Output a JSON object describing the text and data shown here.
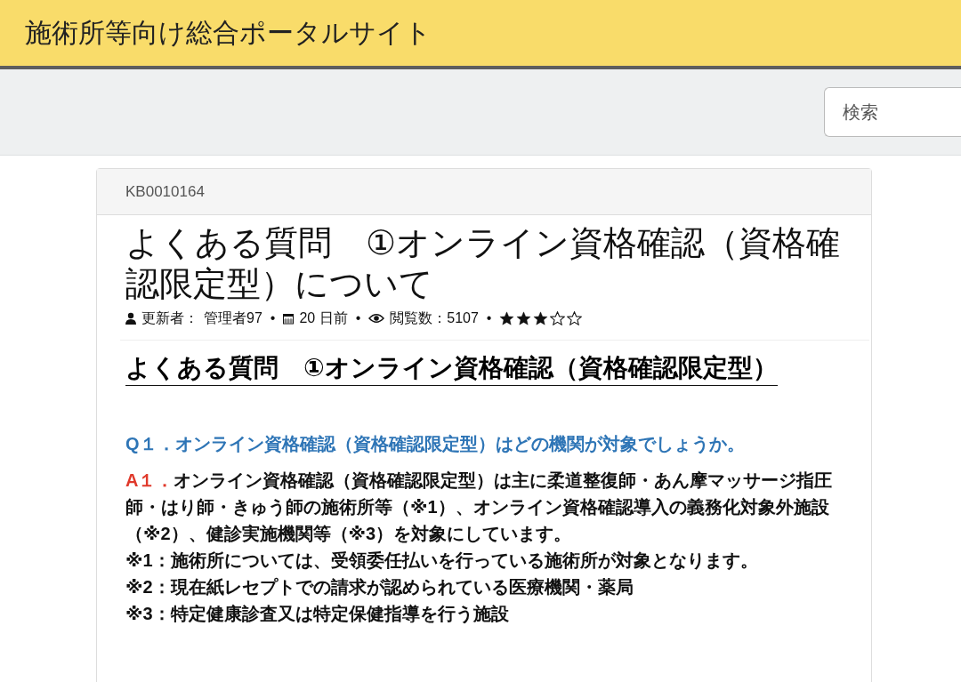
{
  "header": {
    "title": "施術所等向け総合ポータルサイト"
  },
  "search": {
    "placeholder": "検索"
  },
  "article": {
    "number": "KB0010164",
    "title": "よくある質問　①オンライン資格確認（資格確認限定型）について",
    "meta": {
      "updated_by_label": "更新者：",
      "updated_by": "管理者97",
      "age": "20 日前",
      "views_label": "閲覧数：",
      "views": "5107",
      "stars": 3,
      "separators": [
        "•",
        "•",
        "•"
      ]
    },
    "heading": "よくある質問　①オンライン資格確認（資格確認限定型）",
    "question": {
      "label": "Q１．",
      "text": "オンライン資格確認（資格確認限定型）はどの機関が対象でしょうか。"
    },
    "answer": {
      "label": "A１．",
      "text": "オンライン資格確認（資格確認限定型）は主に柔道整復師・あん摩マッサージ指圧師・はり師・きゅう師の施術所等（※1）、オンライン資格確認導入の義務化対象外施設（※2）、健診実施機関等（※3）を対象にしています。"
    },
    "notes": [
      "※1：施術所については、受領委任払いを行っている施術所が対象となります。",
      "※2：現在紙レセプトでの請求が認められている医療機関・薬局",
      "※3：特定健康診査又は特定保健指導を行う施設"
    ]
  }
}
